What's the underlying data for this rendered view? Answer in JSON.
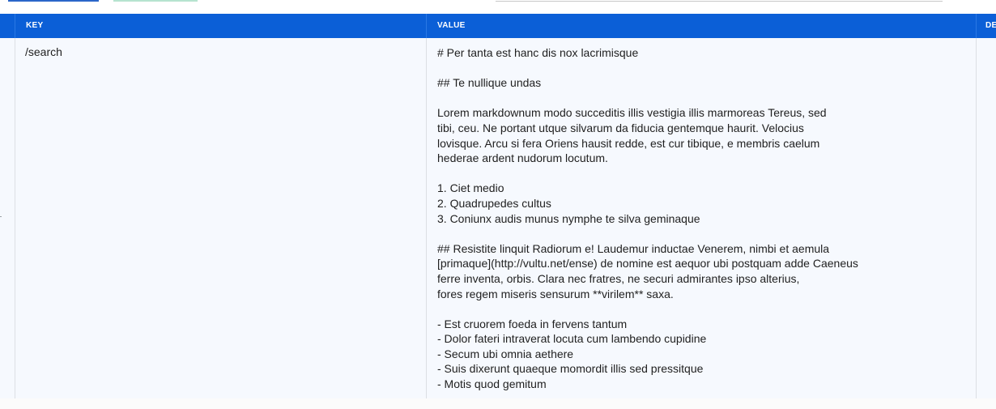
{
  "table": {
    "columns": {
      "key": "KEY",
      "value": "VALUE",
      "description": "DE"
    },
    "rows": [
      {
        "key": "/search",
        "value": "# Per tanta est hanc dis nox lacrimisque\n\n## Te nullique undas\n\nLorem markdownum modo succeditis illis vestigia illis marmoreas Tereus, sed\ntibi, ceu. Ne portant utque silvarum da fiducia gentemque haurit. Velocius\nlovisque. Arcu si fera Oriens hausit redde, est cur tibique, e membris caelum\nhederae ardent nudorum locutum.\n\n1. Ciet medio\n2. Quadrupedes cultus\n3. Coniunx audis munus nymphe te silva geminaque\n\n## Resistite linquit Radiorum e! Laudemur inductae Venerem, nimbi et aemula\n[primaque](http://vultu.net/ense) de nomine est aequor ubi postquam adde Caeneus\nferre inventa, orbis. Clara nec fratres, ne securi admirantes ipso alterius,\nfores regem miseris sensurum **virilem** saxa.\n\n- Est cruorem foeda in fervens tantum\n- Dolor fateri intraverat locuta cum lambendo cupidine\n- Secum ubi omnia aethere\n- Suis dixerunt quaeque momordit illis sed pressitque\n- Motis quod gemitum"
      }
    ]
  },
  "colors": {
    "header_bg": "#0b5fd7",
    "row_bg": "#f6f9fe",
    "accent_tab": "#2b66c9",
    "secondary_tab": "#b6e3cf"
  }
}
